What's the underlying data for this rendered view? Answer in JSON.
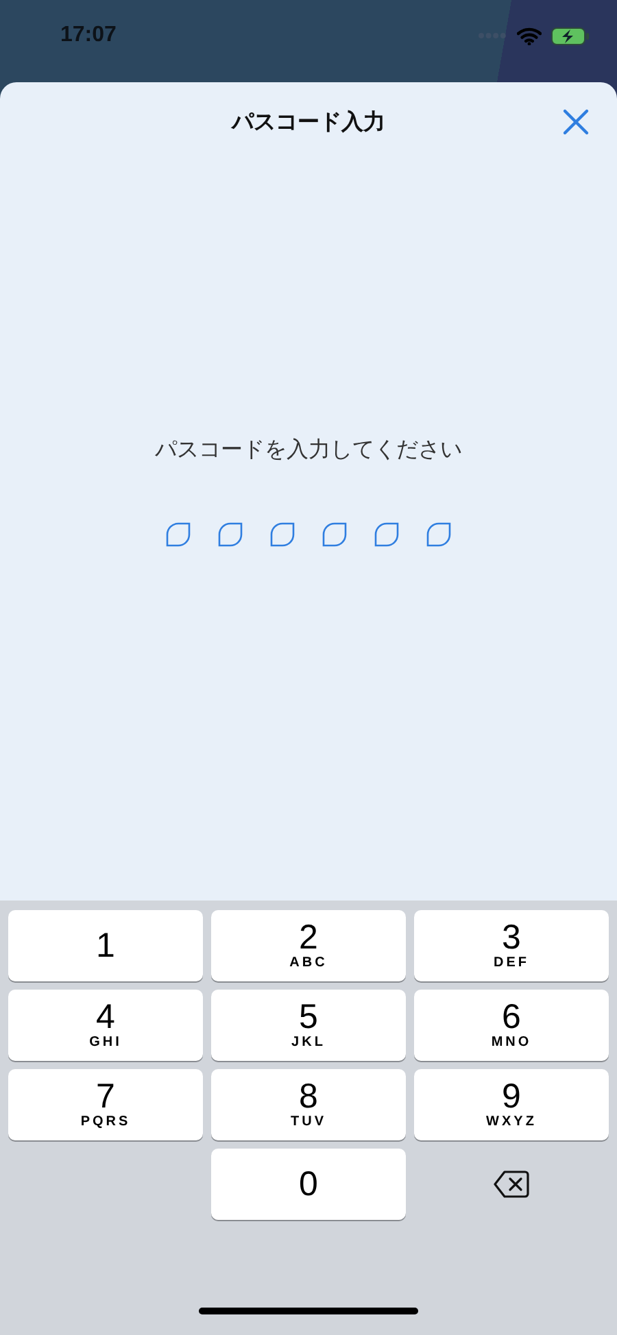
{
  "status_bar": {
    "time": "17:07"
  },
  "sheet": {
    "title": "パスコード入力",
    "prompt": "パスコードを入力してください",
    "slots": [
      {
        "filled": false
      },
      {
        "filled": false
      },
      {
        "filled": false
      },
      {
        "filled": false
      },
      {
        "filled": false
      },
      {
        "filled": false
      }
    ]
  },
  "keypad": [
    {
      "kind": "digit",
      "digit": "1"
    },
    {
      "kind": "digit",
      "digit": "2",
      "letters": "ABC"
    },
    {
      "kind": "digit",
      "digit": "3",
      "letters": "DEF"
    },
    {
      "kind": "digit",
      "digit": "4",
      "letters": "GHI"
    },
    {
      "kind": "digit",
      "digit": "5",
      "letters": "JKL"
    },
    {
      "kind": "digit",
      "digit": "6",
      "letters": "MNO"
    },
    {
      "kind": "digit",
      "digit": "7",
      "letters": "PQRS"
    },
    {
      "kind": "digit",
      "digit": "8",
      "letters": "TUV"
    },
    {
      "kind": "digit",
      "digit": "9",
      "letters": "WXYZ"
    },
    {
      "kind": "blank"
    },
    {
      "kind": "digit",
      "digit": "0"
    },
    {
      "kind": "delete"
    }
  ]
}
